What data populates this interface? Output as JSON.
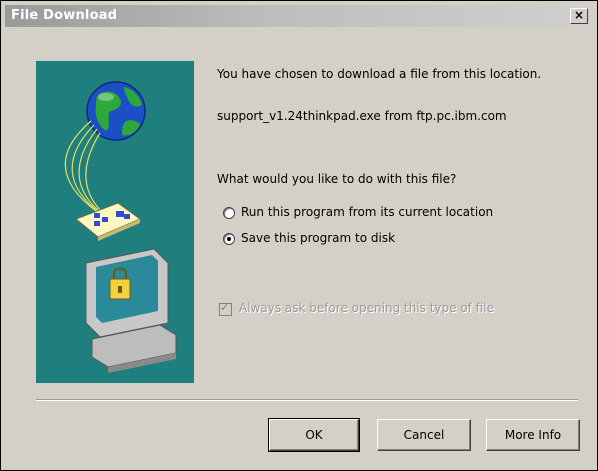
{
  "window": {
    "title": "File Download",
    "close_glyph": "×"
  },
  "message": {
    "intro": "You have chosen to download a file from this location.",
    "file": "support_v1.24thinkpad.exe from ftp.pc.ibm.com",
    "question": "What would you like to do with this file?"
  },
  "options": {
    "run_label": "Run this program from its current location",
    "save_label": "Save this program to disk",
    "selected": "save"
  },
  "always_ask": {
    "label": "Always ask before opening this type of file",
    "checked": true,
    "enabled": false
  },
  "buttons": {
    "ok": "OK",
    "cancel": "Cancel",
    "more_info": "More Info"
  },
  "colors": {
    "art_background": "#1f7f7f",
    "dialog_face": "#d4d0c8"
  },
  "icons": [
    "globe-icon",
    "download-document-icon",
    "computer-lock-icon",
    "close-icon"
  ]
}
